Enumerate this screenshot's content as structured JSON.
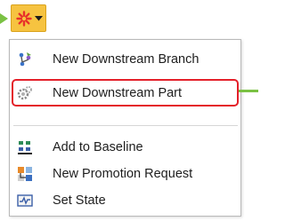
{
  "toolbar": {
    "add_button_icon": "starburst-new-icon",
    "dropdown_icon": "caret-down-icon",
    "accent": "#f6c340"
  },
  "menu": {
    "items": [
      {
        "label": "New Downstream Branch",
        "icon": "branch-icon"
      },
      {
        "label": "New Downstream Part",
        "icon": "part-gear-icon",
        "highlighted": true
      },
      {
        "label": "Add to Baseline",
        "icon": "baseline-icon"
      },
      {
        "label": "New Promotion Request",
        "icon": "promotion-request-icon"
      },
      {
        "label": "Set State",
        "icon": "set-state-icon"
      }
    ]
  },
  "colors": {
    "highlight_border": "#e4202a",
    "connector": "#7ac143"
  }
}
